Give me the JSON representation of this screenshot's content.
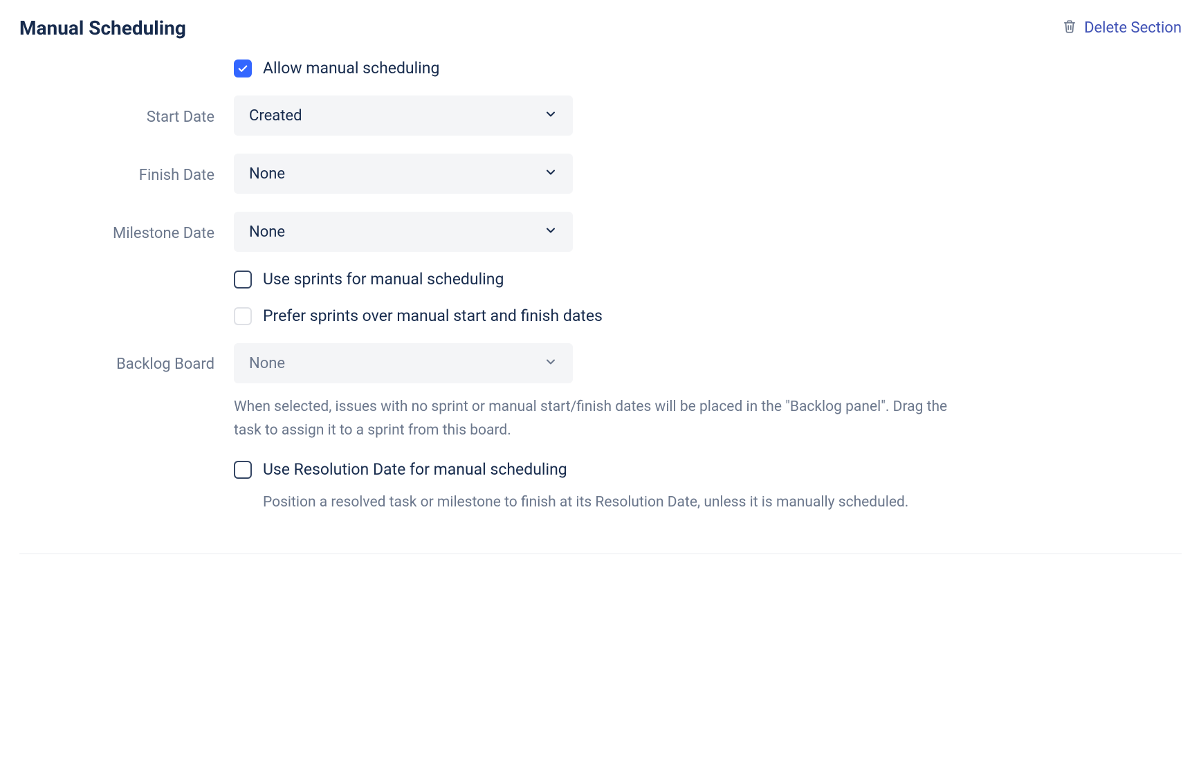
{
  "section": {
    "title": "Manual Scheduling",
    "delete_label": "Delete Section"
  },
  "fields": {
    "allow_manual": {
      "label": "Allow manual scheduling",
      "checked": true
    },
    "start_date": {
      "label": "Start Date",
      "value": "Created"
    },
    "finish_date": {
      "label": "Finish Date",
      "value": "None"
    },
    "milestone_date": {
      "label": "Milestone Date",
      "value": "None"
    },
    "use_sprints": {
      "label": "Use sprints for manual scheduling",
      "checked": false
    },
    "prefer_sprints": {
      "label": "Prefer sprints over manual start and finish dates",
      "checked": false,
      "disabled": true
    },
    "backlog_board": {
      "label": "Backlog Board",
      "value": "None",
      "disabled": true,
      "help": "When selected, issues with no sprint or manual start/finish dates will be placed in the \"Backlog panel\". Drag the task to assign it to a sprint from this board."
    },
    "use_resolution_date": {
      "label": "Use Resolution Date for manual scheduling",
      "checked": false,
      "help": "Position a resolved task or milestone to finish at its Resolution Date, unless it is manually scheduled."
    }
  }
}
